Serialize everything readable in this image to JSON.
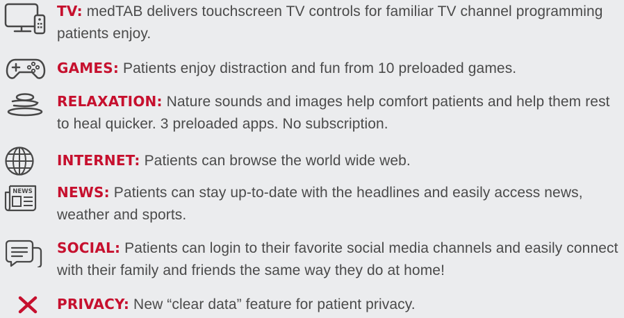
{
  "accent_color": "#c6102e",
  "icon_color": "#474747",
  "features": [
    {
      "icon": "tv-remote-icon",
      "label": "TV:",
      "text": " medTAB delivers touchscreen TV controls for familiar TV channel programming patients enjoy."
    },
    {
      "icon": "game-controller-icon",
      "label": "GAMES:",
      "text": " Patients enjoy distraction and fun from 10 preloaded games."
    },
    {
      "icon": "stacked-stones-icon",
      "label": "RELAXATION:",
      "text": " Nature sounds and images help comfort patients and help them rest to heal quicker. 3 preloaded apps. No subscription."
    },
    {
      "icon": "globe-icon",
      "label": "INTERNET:",
      "text": " Patients can browse the world wide web."
    },
    {
      "icon": "newspaper-icon",
      "label": "NEWS:",
      "text": " Patients can stay up-to-date with the headlines and easily access news, weather and sports."
    },
    {
      "icon": "chat-bubble-icon",
      "label": "SOCIAL:",
      "text": " Patients can login to their favorite social media channels and easily connect with their family and  friends the same way they do at home!"
    },
    {
      "icon": "clear-x-icon",
      "label": "PRIVACY:",
      "text": " New “clear data” feature for patient privacy."
    }
  ],
  "icons": {
    "newspaper_word": "NEWS"
  }
}
